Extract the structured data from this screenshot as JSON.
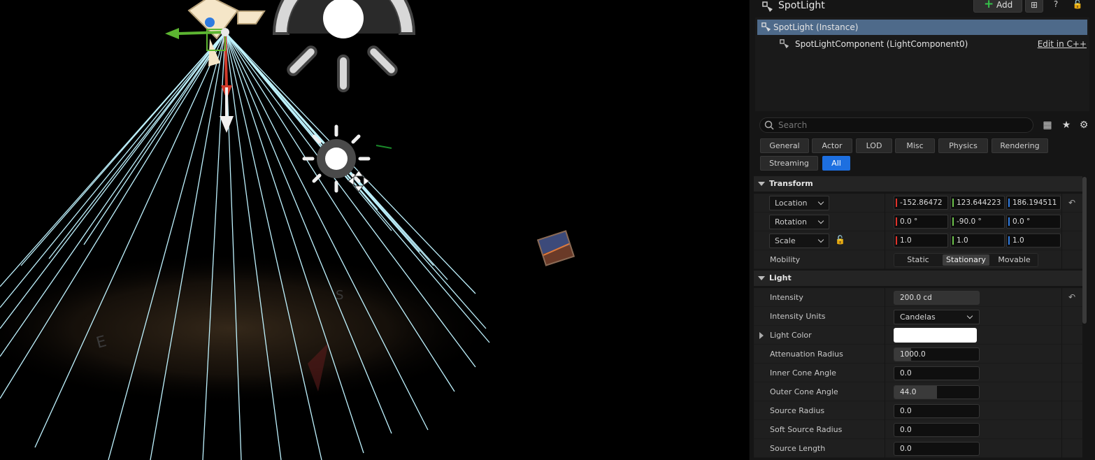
{
  "details": {
    "actor_name": "SpotLight",
    "add_label": "Add",
    "tree": {
      "instance_label": "SpotLight (Instance)",
      "component_label": "SpotLightComponent (LightComponent0)",
      "edit_cpp_label": "Edit in C++"
    },
    "search_placeholder": "Search",
    "categories": [
      "General",
      "Actor",
      "LOD",
      "Misc",
      "Physics",
      "Rendering",
      "Streaming",
      "All"
    ],
    "active_category": "All",
    "transform": {
      "title": "Transform",
      "location_label": "Location",
      "location": [
        "-152.86472",
        "123.644223",
        "186.194511"
      ],
      "rotation_label": "Rotation",
      "rotation": [
        "0.0 °",
        "-90.0 °",
        "0.0 °"
      ],
      "scale_label": "Scale",
      "scale": [
        "1.0",
        "1.0",
        "1.0"
      ],
      "mobility_label": "Mobility",
      "mobility_options": [
        "Static",
        "Stationary",
        "Movable"
      ],
      "mobility_selected": "Stationary"
    },
    "light": {
      "title": "Light",
      "intensity_label": "Intensity",
      "intensity": "200.0 cd",
      "intensity_units_label": "Intensity Units",
      "intensity_units": "Candelas",
      "light_color_label": "Light Color",
      "light_color": "#ffffff",
      "attenuation_label": "Attenuation Radius",
      "attenuation": "1000.0",
      "inner_cone_label": "Inner Cone Angle",
      "inner_cone": "0.0",
      "outer_cone_label": "Outer Cone Angle",
      "outer_cone": "44.0",
      "outer_cone_fill_fraction": 0.5,
      "source_radius_label": "Source Radius",
      "source_radius": "0.0",
      "soft_source_radius_label": "Soft Source Radius",
      "soft_source_radius": "0.0",
      "source_length_label": "Source Length",
      "source_length": "0.0"
    },
    "axis_colors": {
      "x": "#e0332b",
      "y": "#6cc24a",
      "z": "#2f7be0"
    },
    "accent_color": "#1d6fe0"
  },
  "viewport": {
    "background": "#000000",
    "cone_line_color": "#bff3ff"
  }
}
